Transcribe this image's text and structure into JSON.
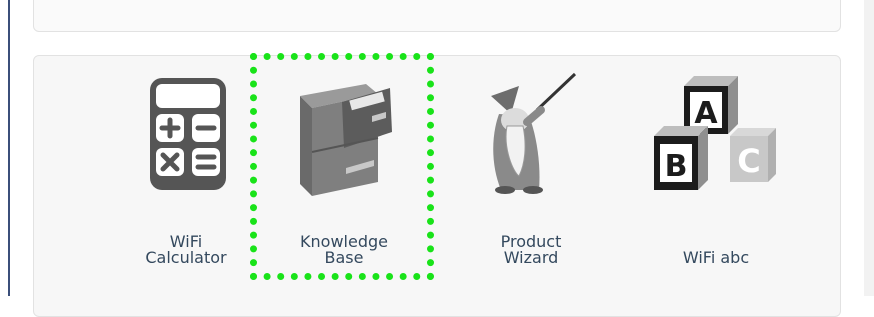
{
  "tiles": [
    {
      "id": "wifi-calculator",
      "label_line1": "WiFi",
      "label_line2": "Calculator",
      "icon": "calculator-icon"
    },
    {
      "id": "knowledge-base",
      "label_line1": "Knowledge",
      "label_line2": "Base",
      "icon": "file-cabinet-icon",
      "highlighted": true
    },
    {
      "id": "product-wizard",
      "label_line1": "Product",
      "label_line2": "Wizard",
      "icon": "wizard-icon"
    },
    {
      "id": "wifi-abc",
      "label_line1": "",
      "label_line2": "WiFi abc",
      "icon": "abc-blocks-icon"
    }
  ],
  "blocks": {
    "a": "A",
    "b": "B",
    "c": "C"
  },
  "colors": {
    "highlight": "#19e319",
    "label": "#34495e",
    "panel": "#f7f7f7"
  }
}
